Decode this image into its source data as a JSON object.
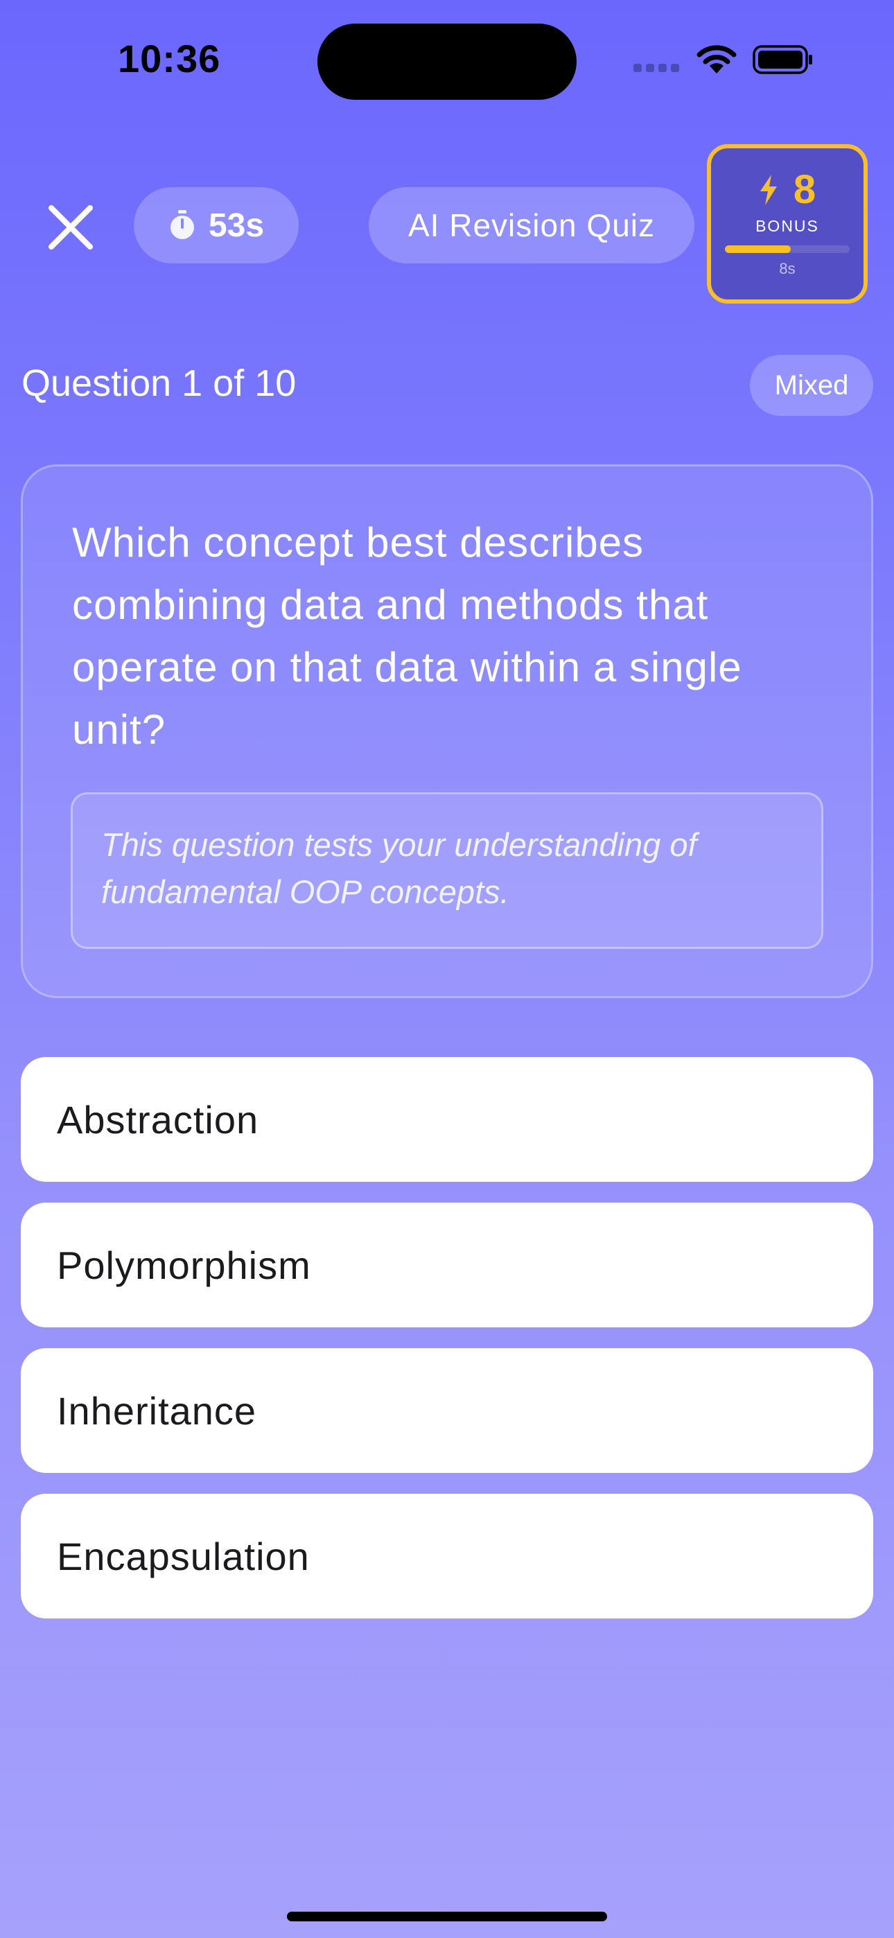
{
  "status_bar": {
    "time": "10:36"
  },
  "header": {
    "timer": "53s",
    "title": "AI Revision Quiz"
  },
  "bonus": {
    "value": "8",
    "label": "BONUS",
    "seconds_left": "8s",
    "progress_fraction": 0.53,
    "accent_color": "#f7c02b"
  },
  "question": {
    "counter": "Question 1 of 10",
    "difficulty": "Mixed",
    "text": "Which concept best describes combining data and methods that operate on that data within a single unit?",
    "hint": "This question tests your understanding of fundamental OOP concepts."
  },
  "answers": [
    {
      "label": "Abstraction"
    },
    {
      "label": "Polymorphism"
    },
    {
      "label": "Inheritance"
    },
    {
      "label": "Encapsulation"
    }
  ],
  "icons": {
    "close": "close-icon",
    "timer": "stopwatch-icon",
    "bonus": "lightning-icon"
  }
}
